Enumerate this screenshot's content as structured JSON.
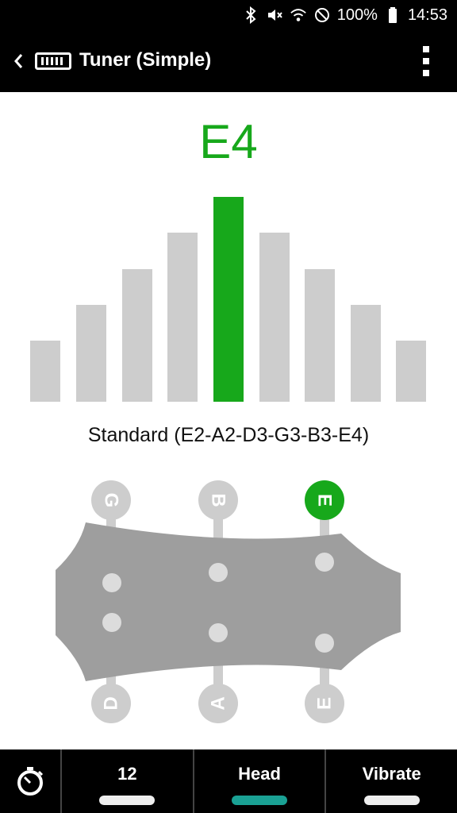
{
  "status_bar": {
    "battery": "100%",
    "time": "14:53",
    "icons": [
      "bluetooth-icon",
      "mute-icon",
      "wifi-icon",
      "blocked-icon",
      "battery-icon"
    ]
  },
  "app_bar": {
    "title": "Tuner (Simple)",
    "back_icon": "chevron-left-icon",
    "logo_icon": "tuner-logo-icon",
    "menu_icon": "more-vert-icon"
  },
  "note": "E4",
  "colors": {
    "accent": "#17a81b",
    "bar_idle": "#cdcdcd",
    "active_tab": "#1aa194"
  },
  "meter": {
    "bar_count": 9,
    "active_index": 4
  },
  "tuning_label": "Standard (E2-A2-D3-G3-B3-E4)",
  "strings": {
    "top": [
      {
        "label": "G",
        "active": false
      },
      {
        "label": "B",
        "active": false
      },
      {
        "label": "E",
        "active": true
      }
    ],
    "bottom": [
      {
        "label": "D",
        "active": false
      },
      {
        "label": "A",
        "active": false
      },
      {
        "label": "E",
        "active": false
      }
    ]
  },
  "bottom_bar": {
    "timer_icon": "timer-icon",
    "tabs": [
      {
        "label": "12",
        "active": false
      },
      {
        "label": "Head",
        "active": true
      },
      {
        "label": "Vibrate",
        "active": false
      }
    ]
  }
}
